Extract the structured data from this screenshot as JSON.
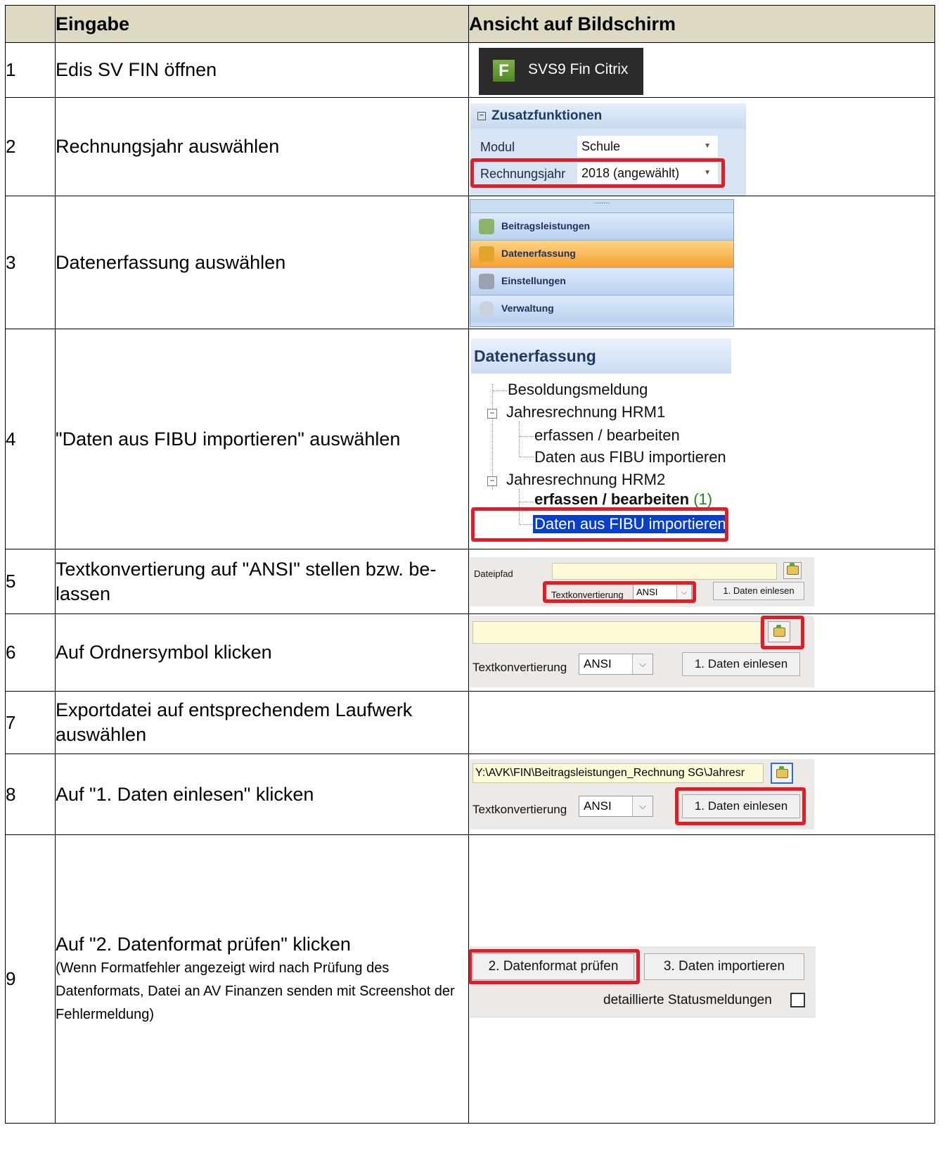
{
  "headers": {
    "number": "",
    "input": "Eingabe",
    "view": "Ansicht auf Bildschirm"
  },
  "rows": [
    {
      "num": "1",
      "text": "Edis SV FIN öffnen"
    },
    {
      "num": "2",
      "text": "Rechnungsjahr auswählen"
    },
    {
      "num": "3",
      "text": "Datenerfassung auswählen"
    },
    {
      "num": "4",
      "text": "\"Daten aus FIBU importieren\" auswählen"
    },
    {
      "num": "5",
      "text": "Textkonvertierung auf \"ANSI\" stellen bzw. be-lassen"
    },
    {
      "num": "6",
      "text": "Auf Ordnersymbol klicken"
    },
    {
      "num": "7",
      "text": "Exportdatei auf entsprechendem Laufwerk auswählen"
    },
    {
      "num": "8",
      "text": "Auf \"1. Daten einlesen\" klicken"
    },
    {
      "num": "9",
      "text": "Auf \"2. Datenformat prüfen\" klicken",
      "note": "(Wenn Formatfehler angezeigt wird nach Prüfung des Datenformats, Datei an AV Finanzen senden mit Screenshot der Fehlermeldung)"
    }
  ],
  "shots": {
    "app_tile": {
      "icon_letter": "F",
      "label": "SVS9 Fin Citrix"
    },
    "zusatz": {
      "title": "Zusatzfunktionen",
      "modul_label": "Modul",
      "modul_value": "Schule",
      "jahr_label": "Rechnungsjahr",
      "jahr_value": "2018 (angewählt)"
    },
    "nav": {
      "items": [
        "Beitragsleistungen",
        "Datenerfassung",
        "Einstellungen",
        "Verwaltung"
      ],
      "selected": "Datenerfassung"
    },
    "tree": {
      "title": "Datenerfassung",
      "n1": "Besoldungsmeldung",
      "n2": "Jahresrechnung HRM1",
      "n2a": "erfassen / bearbeiten",
      "n2b": "Daten aus FIBU importieren",
      "n3": "Jahresrechnung HRM2",
      "n3a": "erfassen / bearbeiten",
      "n3a_count": "(1)",
      "n3b": "Daten aus FIBU importieren"
    },
    "import": {
      "dateipfad_label": "Dateipfad",
      "textkonv_label": "Textkonvertierung",
      "encoding": "ANSI",
      "read_button": "1. Daten einlesen",
      "path_value": "Y:\\AVK\\FIN\\Beitragsleistungen_Rechnung SG\\Jahresr",
      "check_button": "2. Datenformat prüfen",
      "import_button": "3. Daten importieren",
      "status_label": "detaillierte Statusmeldungen"
    }
  },
  "colors": {
    "header_bg": "#ddd9c3",
    "highlight_red": "#e11d2a",
    "selection_blue": "#0a3fc8"
  }
}
